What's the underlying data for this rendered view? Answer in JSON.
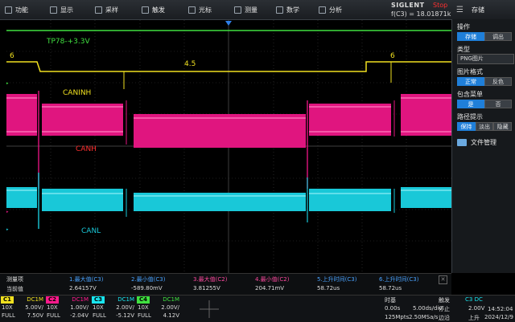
{
  "menu": {
    "items": [
      {
        "label": "功能",
        "name": "menu-function",
        "icon": "function-icon"
      },
      {
        "label": "显示",
        "name": "menu-display",
        "icon": "display-icon"
      },
      {
        "label": "采样",
        "name": "menu-acquire",
        "icon": "acquire-icon"
      },
      {
        "label": "触发",
        "name": "menu-trigger",
        "icon": "trigger-icon"
      },
      {
        "label": "光标",
        "name": "menu-cursor",
        "icon": "cursor-icon"
      },
      {
        "label": "测量",
        "name": "menu-measure",
        "icon": "measure-icon"
      },
      {
        "label": "数学",
        "name": "menu-math",
        "icon": "math-icon"
      },
      {
        "label": "分析",
        "name": "menu-analysis",
        "icon": "analysis-icon"
      }
    ],
    "brand": "SIGLENT",
    "state": "Stop",
    "freq": "f(C3) = 18.01871kHz"
  },
  "sidebar": {
    "title": "存储",
    "operation_label": "操作",
    "operation_options": [
      "存储",
      "调出"
    ],
    "type_label": "类型",
    "type_value": "PNG图片",
    "color_label": "图片格式",
    "color_options": [
      "正常",
      "反色"
    ],
    "menu_label": "包含菜单",
    "menu_options": [
      "是",
      "否"
    ],
    "path_label": "路径提示",
    "path_options": [
      "保持",
      "淡出",
      "隐藏"
    ],
    "file_manager": "文件管理"
  },
  "waveform_labels": {
    "c1_label": "TP78-+3.3V",
    "c2_label": "CANH",
    "c3_label": "CANL",
    "yellow_label": "CANINH",
    "val_left": "6",
    "val_mid": "4.5",
    "val_right": "6"
  },
  "measurements": {
    "header_label": "测量项",
    "value_label": "当前值",
    "items": [
      {
        "name": "1.最大值(C3)",
        "value": "2.64157V",
        "color": "#4aa3ff"
      },
      {
        "name": "2.最小值(C3)",
        "value": "-589.80mV",
        "color": "#4aa3ff"
      },
      {
        "name": "3.最大值(C2)",
        "value": "3.81255V",
        "color": "#ff4aa0"
      },
      {
        "name": "4.最小值(C2)",
        "value": "204.71mV",
        "color": "#ff4aa0"
      },
      {
        "name": "5.上升时间(C3)",
        "value": "58.72us",
        "color": "#4aa3ff"
      },
      {
        "name": "6.上升时间(C3)",
        "value": "58.72us",
        "color": "#4aa3ff"
      }
    ]
  },
  "channels": [
    {
      "tag": "C1",
      "coupling": "DC1M",
      "probe": "10X",
      "scale": "5.00V/",
      "bw": "FULL",
      "offset": "7.50V",
      "color": "#f0e020"
    },
    {
      "tag": "C2",
      "coupling": "DC1M",
      "probe": "10X",
      "scale": "1.00V/",
      "bw": "FULL",
      "offset": "-2.04V",
      "color": "#ff1a8c"
    },
    {
      "tag": "C3",
      "coupling": "DC1M",
      "probe": "10X",
      "scale": "2.00V/",
      "bw": "FULL",
      "offset": "-5.12V",
      "color": "#19e6f0"
    },
    {
      "tag": "C4",
      "coupling": "DC1M",
      "probe": "10X",
      "scale": "2.00V/",
      "bw": "FULL",
      "offset": "4.12V",
      "color": "#40e040"
    }
  ],
  "timebase": {
    "label": "时基",
    "delay": "0.00s",
    "scale": "5.00ds/div",
    "rate_pts": "125Mpts",
    "rate": "2.50MSa/s"
  },
  "trigger": {
    "label": "触发",
    "source": "C3 DC",
    "level": "2.00V",
    "mode1": "停止",
    "mode2": "边沿",
    "slope": "上升"
  },
  "clock": {
    "time": "14:52:04",
    "date": "2024/12/9"
  }
}
